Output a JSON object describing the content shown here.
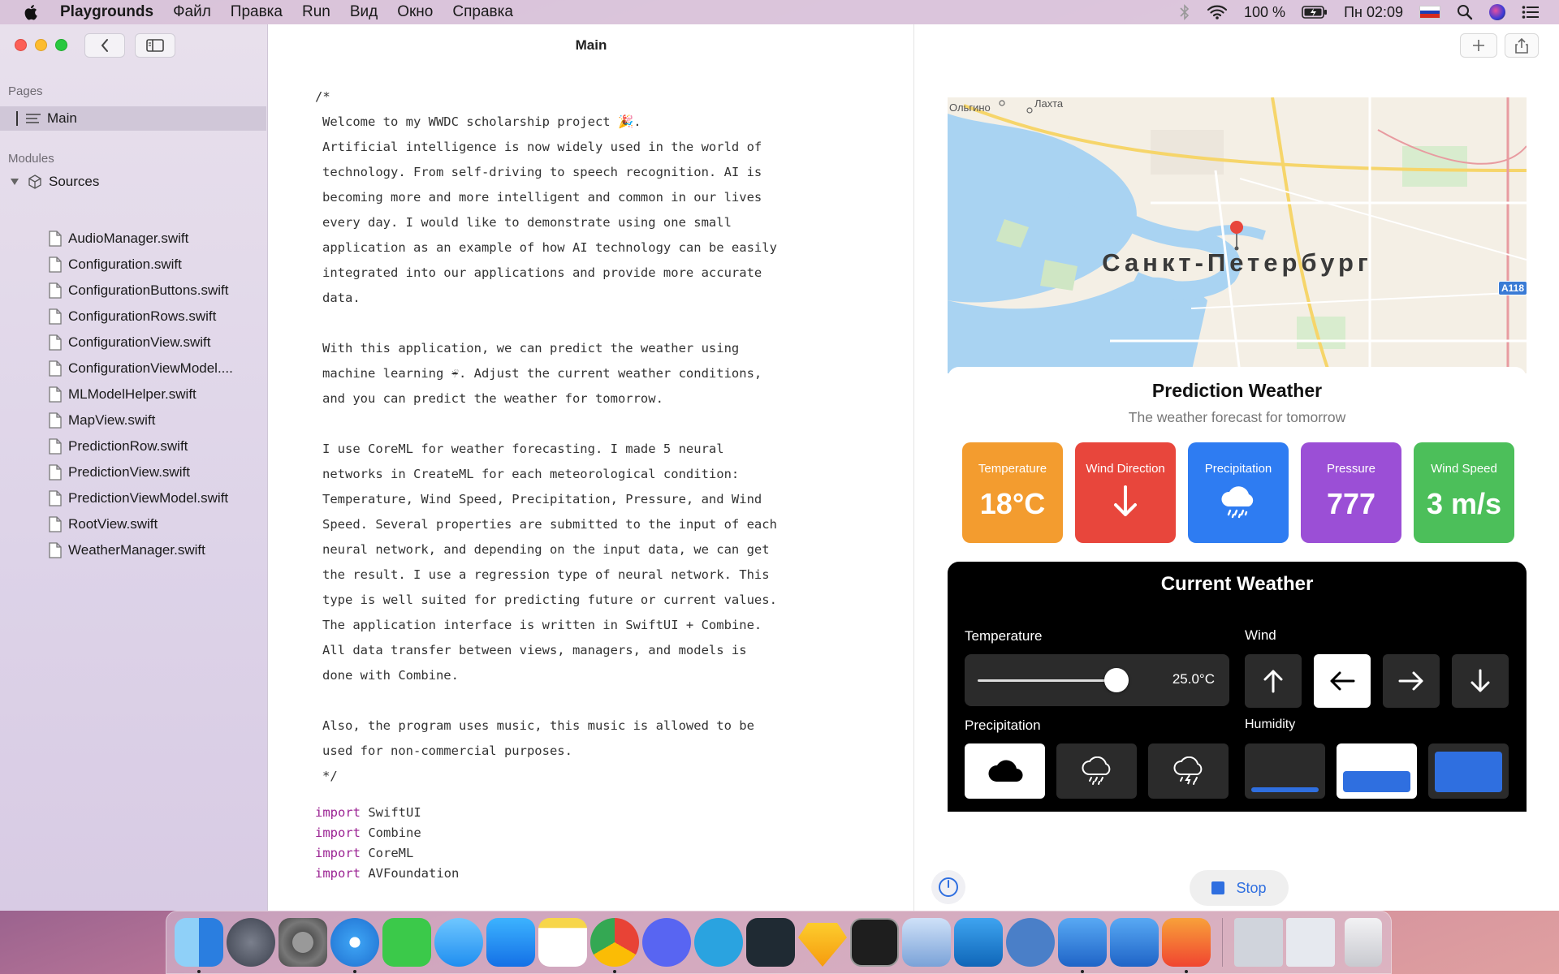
{
  "menubar": {
    "app_name": "Playgrounds",
    "items": [
      "Файл",
      "Правка",
      "Run",
      "Вид",
      "Окно",
      "Справка"
    ],
    "battery": "100 %",
    "clock": "Пн 02:09"
  },
  "sidebar": {
    "pages_label": "Pages",
    "main_page": "Main",
    "modules_label": "Modules",
    "sources_label": "Sources",
    "files": [
      "AudioManager.swift",
      "Configuration.swift",
      "ConfigurationButtons.swift",
      "ConfigurationRows.swift",
      "ConfigurationView.swift",
      "ConfigurationViewModel....",
      "MLModelHelper.swift",
      "MapView.swift",
      "PredictionRow.swift",
      "PredictionView.swift",
      "PredictionViewModel.swift",
      "RootView.swift",
      "WeatherManager.swift"
    ]
  },
  "editor": {
    "title": "Main",
    "comment_lines": [
      "/*",
      "Welcome to my WWDC scholarship project 🎉.",
      "Artificial intelligence is now widely used in the world of",
      "technology. From self-driving to speech recognition. AI is",
      "becoming more and more intelligent and common in our lives",
      "every day. I would like to demonstrate using one small",
      "application as an example of how AI technology can be easily",
      "integrated into our applications and provide more accurate",
      "data.",
      "",
      "With this application, we can predict the weather using",
      "machine learning ☔. Adjust the current weather conditions,",
      "and you can predict the weather for tomorrow.",
      "",
      "I use CoreML for weather forecasting. I made 5 neural",
      "networks in CreateML for each meteorological condition:",
      "Temperature, Wind Speed, Precipitation, Pressure, and Wind",
      "Speed. Several properties are submitted to the input of each",
      "neural network, and depending on the input data, we can get",
      "the result. I use a regression type of neural network. This",
      "type is well suited for predicting future or current values.",
      "The application interface is written in SwiftUI + Combine.",
      "All data transfer between views, managers, and models is",
      "done with Combine.",
      "",
      "Also, the program uses music, this music is allowed to be",
      "used for non-commercial purposes.",
      "*/"
    ],
    "imports": [
      {
        "kw": "import",
        "mod": "SwiftUI"
      },
      {
        "kw": "import",
        "mod": "Combine"
      },
      {
        "kw": "import",
        "mod": "CoreML"
      },
      {
        "kw": "import",
        "mod": "AVFoundation"
      }
    ]
  },
  "map": {
    "city": "Санкт-Петербург",
    "place1": "Ольгино",
    "place2": "Лахта",
    "road": "A118"
  },
  "prediction": {
    "title": "Prediction Weather",
    "subtitle": "The weather forecast for tomorrow",
    "cards": [
      {
        "label": "Temperature",
        "value": "18°C",
        "color": "#f39c2f"
      },
      {
        "label": "Wind Direction",
        "value": "",
        "icon": "arrow-down-icon",
        "color": "#e8463c"
      },
      {
        "label": "Precipitation",
        "value": "",
        "icon": "rain-cloud-icon",
        "color": "#2e7cf2"
      },
      {
        "label": "Pressure",
        "value": "777",
        "color": "#9b4fd6"
      },
      {
        "label": "Wind Speed",
        "value": "3 m/s",
        "color": "#4cbf5a"
      }
    ]
  },
  "current": {
    "title": "Current Weather",
    "temperature_label": "Temperature",
    "temperature_value": "25.0°C",
    "temperature_slider_level": 0.55,
    "wind_label": "Wind",
    "precipitation_label": "Precipitation",
    "humidity_label": "Humidity"
  },
  "controls": {
    "stop_label": "Stop"
  },
  "colors": {
    "accent": "#2f6fe0",
    "keyword": "#9b2393"
  }
}
